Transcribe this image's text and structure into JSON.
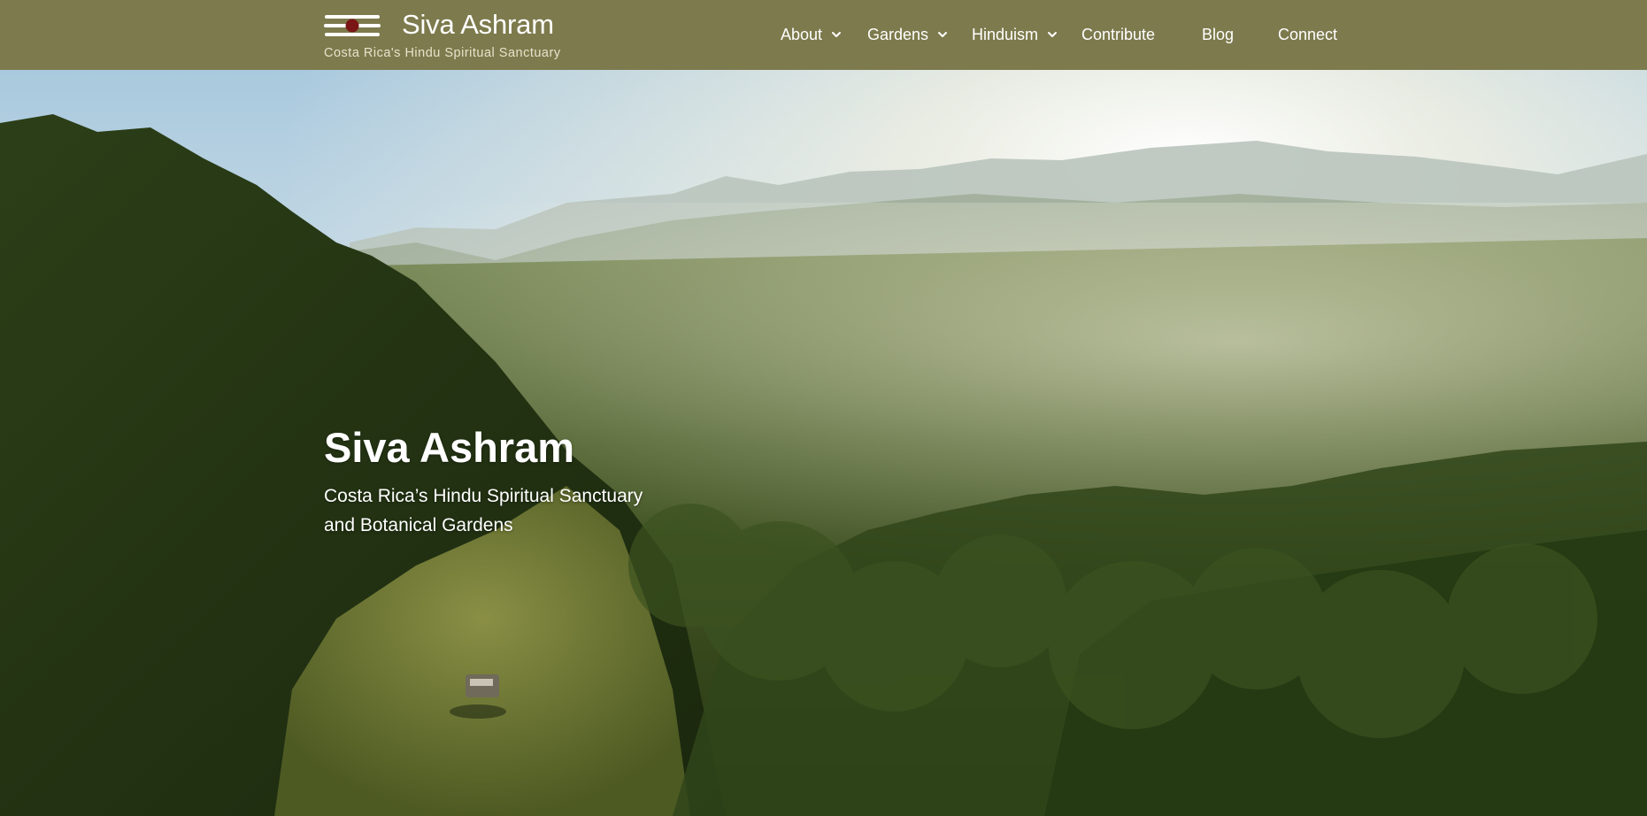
{
  "header": {
    "title": "Siva Ashram",
    "tagline": "Costa Rica's Hindu Spiritual Sanctuary",
    "background_color": "#7d7a4d",
    "logo_icon": "tilaka-logo-icon"
  },
  "nav": {
    "items": [
      {
        "label": "About",
        "has_dropdown": true
      },
      {
        "label": "Gardens",
        "has_dropdown": true
      },
      {
        "label": "Hinduism",
        "has_dropdown": true
      },
      {
        "label": "Contribute",
        "has_dropdown": false
      },
      {
        "label": "Blog",
        "has_dropdown": false
      },
      {
        "label": "Connect",
        "has_dropdown": false
      }
    ]
  },
  "hero": {
    "title": "Siva Ashram",
    "subtitle_line1": "Costa Rica’s Hindu Spiritual Sanctuary",
    "subtitle_line2": "and Botanical Gardens"
  }
}
